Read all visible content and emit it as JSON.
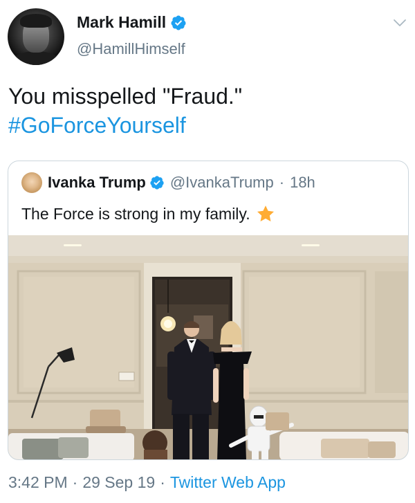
{
  "author": {
    "name": "Mark Hamill",
    "handle": "@HamillHimself"
  },
  "tweet": {
    "text": "You misspelled \"Fraud.\"",
    "hashtag": "#GoForceYourself"
  },
  "quoted": {
    "name": "Ivanka Trump",
    "handle": "@IvankaTrump",
    "separator": "·",
    "age": "18h",
    "text": "The Force is strong in my family."
  },
  "footer": {
    "time": "3:42 PM",
    "date": "29 Sep 19",
    "separator": "·",
    "source": "Twitter Web App"
  },
  "colors": {
    "link": "#1b95e0",
    "verified": "#1da1f2",
    "secondary_text": "#657786",
    "border": "#ccd6dd",
    "star": "#ffac33"
  },
  "icons": {
    "verified": "verified-badge-icon",
    "caret": "chevron-down-icon",
    "star": "star-emoji-icon"
  }
}
